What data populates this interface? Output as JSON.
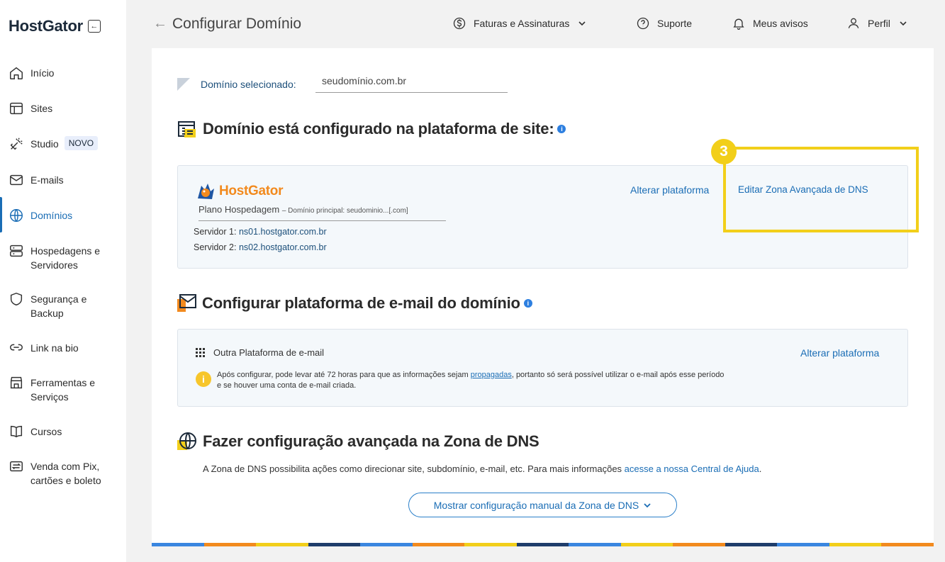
{
  "brand": {
    "name": "HostGator"
  },
  "sidebar": {
    "items": [
      {
        "label": "Início"
      },
      {
        "label": "Sites"
      },
      {
        "label": "Studio",
        "badge": "NOVO"
      },
      {
        "label": "E-mails"
      },
      {
        "label": "Domínios"
      },
      {
        "label_line1": "Hospedagens e",
        "label_line2": "Servidores"
      },
      {
        "label_line1": "Segurança e",
        "label_line2": "Backup"
      },
      {
        "label": "Link na bio"
      },
      {
        "label_line1": "Ferramentas e",
        "label_line2": "Serviços"
      },
      {
        "label": "Cursos"
      },
      {
        "label_line1": "Venda com Pix,",
        "label_line2": "cartões e boleto"
      }
    ]
  },
  "header": {
    "title": "Configurar Domínio",
    "billing": "Faturas e Assinaturas",
    "support": "Suporte",
    "notices": "Meus avisos",
    "profile": "Perfil"
  },
  "domain": {
    "label": "Domínio selecionado:",
    "value": "seudomínio.com.br"
  },
  "site_platform": {
    "title": "Domínio está configurado na plataforma de site:",
    "provider": "HostGator",
    "plan": "Plano Hospedagem",
    "plan_detail": "– Domínio principal: seudominio...[.com]",
    "server1_label": "Servidor 1:",
    "server1": "ns01.hostgator.com.br",
    "server2_label": "Servidor 2:",
    "server2": "ns02.hostgator.com.br",
    "change_link": "Alterar plataforma",
    "edit_dns_link": "Editar Zona Avançada de DNS"
  },
  "step": {
    "number": "3"
  },
  "email_platform": {
    "title": "Configurar plataforma de e-mail do domínio",
    "platform": "Outra Plataforma de e-mail",
    "change_link": "Alterar plataforma",
    "notice_before": "Após configurar, pode levar até 72 horas para que as informações sejam ",
    "notice_link": "propagadas",
    "notice_after": ", portanto só será possível utilizar o e-mail após esse período",
    "notice_line2": "e se houver uma conta de e-mail criada."
  },
  "dns": {
    "title": "Fazer configuração avançada na Zona de DNS",
    "desc": "A Zona de DNS possibilita ações como direcionar site, subdomínio, e-mail, etc. Para mais informações ",
    "desc_link": "acesse a nossa Central de Ajuda",
    "desc_end": ".",
    "button": "Mostrar configuração manual da Zona de DNS"
  },
  "colors": {
    "accent": "#1a6db5",
    "highlight": "#f2cf1a",
    "brand_orange": "#f28a1e"
  },
  "icons": {
    "home": "home-icon",
    "sites": "layout-icon",
    "studio": "magic-wand-icon",
    "emails": "mail-icon",
    "domains": "globe-icon",
    "hosting": "server-icon",
    "security": "shield-icon",
    "link": "link-icon",
    "tools": "store-icon",
    "courses": "book-icon",
    "sales": "exchange-icon"
  }
}
